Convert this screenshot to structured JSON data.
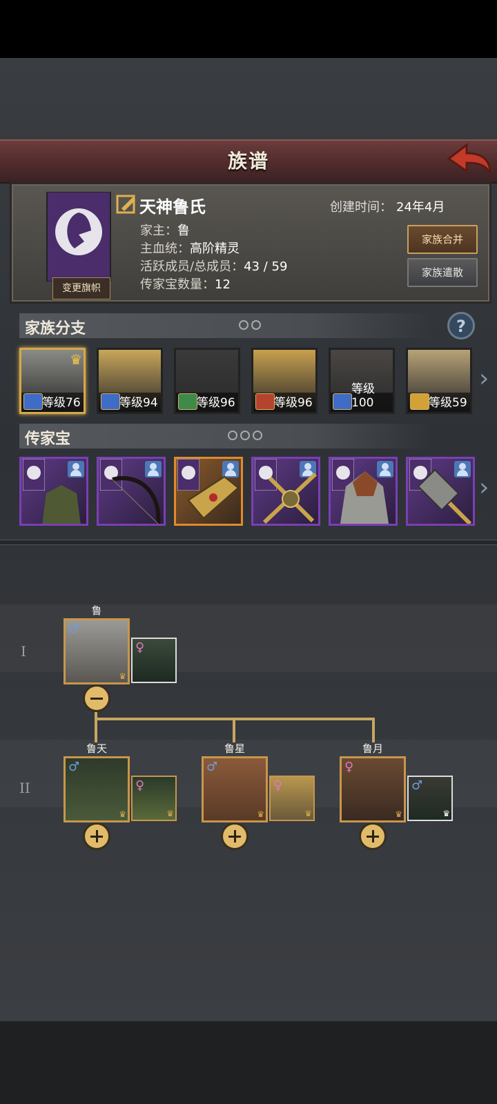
{
  "header": {
    "title": "族谱"
  },
  "clan": {
    "name": "天神鲁氏",
    "created_label": "创建时间：",
    "created_value": "24年4月",
    "patriarch_label": "家主：",
    "patriarch_value": "鲁",
    "bloodline_label": "主血统：",
    "bloodline_value": "高阶精灵",
    "members_label": "活跃成员/总成员：",
    "members_value": "43 / 59",
    "heirloom_count_label": "传家宝数量：",
    "heirloom_count_value": "12",
    "change_banner_label": "变更旗帜",
    "merge_label": "家族合并",
    "disband_label": "家族遣散"
  },
  "branches": {
    "title": "家族分支",
    "items": [
      {
        "level_text": "等级76",
        "selected": true,
        "crown": true,
        "class_color": "#3e6cc7",
        "portrait": "#8b8b86"
      },
      {
        "level_text": "等级94",
        "selected": false,
        "crown": false,
        "class_color": "#3e6cc7",
        "portrait": "#c9a65a"
      },
      {
        "level_text": "等级96",
        "selected": false,
        "crown": false,
        "class_color": "#3e8a4a",
        "portrait": "#3a3a3a"
      },
      {
        "level_text": "等级96",
        "selected": false,
        "crown": false,
        "class_color": "#b5442e",
        "portrait": "#c8a04e"
      },
      {
        "level_text": "等级100",
        "selected": false,
        "crown": false,
        "class_color": "#3e6cc7",
        "portrait": "#4a4644"
      },
      {
        "level_text": "等级59",
        "selected": false,
        "crown": false,
        "class_color": "#d2a236",
        "portrait": "#b8a277"
      }
    ]
  },
  "heirlooms": {
    "title": "传家宝",
    "items": [
      {
        "name": "armor-heirloom",
        "rarity": "purple"
      },
      {
        "name": "bow-heirloom",
        "rarity": "purple"
      },
      {
        "name": "crossguard-heirloom",
        "rarity": "orange"
      },
      {
        "name": "crossbow-heirloom",
        "rarity": "purple"
      },
      {
        "name": "chainmail-heirloom",
        "rarity": "purple"
      },
      {
        "name": "hammer-heirloom",
        "rarity": "purple"
      }
    ]
  },
  "tree": {
    "generations": [
      "I",
      "II"
    ],
    "gen1": {
      "name": "鲁"
    },
    "gen2": [
      {
        "name": "鲁天"
      },
      {
        "name": "鲁星"
      },
      {
        "name": "鲁月"
      }
    ]
  }
}
